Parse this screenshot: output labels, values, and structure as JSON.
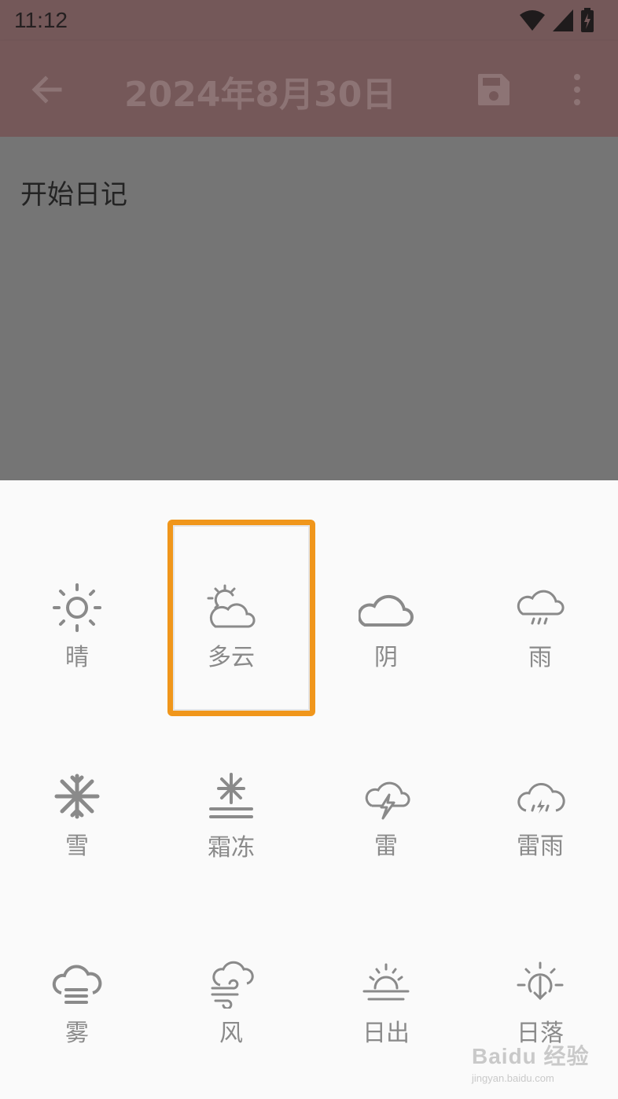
{
  "status_bar": {
    "time": "11:12",
    "icons": [
      "wifi-icon",
      "signal-icon",
      "battery-charging-icon"
    ]
  },
  "app_bar": {
    "title": "2024年8月30日",
    "back_icon": "arrow-left-icon",
    "save_icon": "save-icon",
    "more_icon": "more-vertical-icon"
  },
  "editor": {
    "placeholder": "开始日记"
  },
  "weather_sheet": {
    "selected": "多云",
    "items": [
      {
        "label": "晴",
        "icon": "sunny-icon"
      },
      {
        "label": "多云",
        "icon": "partly-cloudy-icon"
      },
      {
        "label": "阴",
        "icon": "overcast-icon"
      },
      {
        "label": "雨",
        "icon": "rain-icon"
      },
      {
        "label": "雪",
        "icon": "snow-icon"
      },
      {
        "label": "霜冻",
        "icon": "frost-icon"
      },
      {
        "label": "雷",
        "icon": "thunder-icon"
      },
      {
        "label": "雷雨",
        "icon": "thunderstorm-icon"
      },
      {
        "label": "雾",
        "icon": "fog-icon"
      },
      {
        "label": "风",
        "icon": "wind-icon"
      },
      {
        "label": "日出",
        "icon": "sunrise-icon"
      },
      {
        "label": "日落",
        "icon": "sunset-icon"
      }
    ]
  },
  "watermark": {
    "top": "Baidu 经验",
    "bottom": "jingyan.baidu.com"
  },
  "colors": {
    "status_bar": "#745859",
    "app_bar": "#755859",
    "scrim": "#757575",
    "sheet": "#fafafa",
    "icon_gray": "#8a8a8a",
    "highlight": "#f0961b"
  }
}
